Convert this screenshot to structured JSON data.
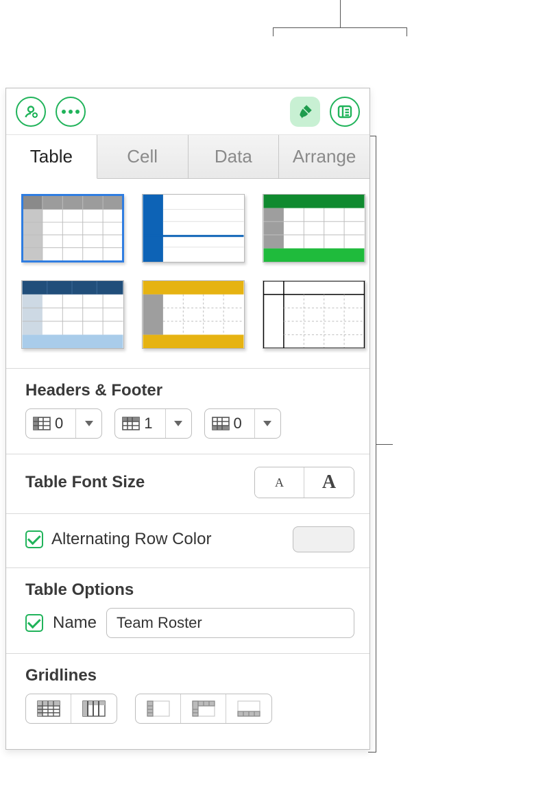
{
  "tabs": {
    "table": "Table",
    "cell": "Cell",
    "data": "Data",
    "arrange": "Arrange"
  },
  "sections": {
    "headers_footer": "Headers & Footer",
    "font_size": "Table Font Size",
    "alternating": "Alternating Row Color",
    "table_options": "Table Options",
    "name_label": "Name",
    "gridlines": "Gridlines"
  },
  "headers_footer": {
    "header_cols": "0",
    "header_rows": "1",
    "footer_rows": "0"
  },
  "font_size": {
    "small_glyph": "A",
    "big_glyph": "A"
  },
  "table_name": "Team Roster",
  "alternating_checked": true,
  "name_checked": true
}
